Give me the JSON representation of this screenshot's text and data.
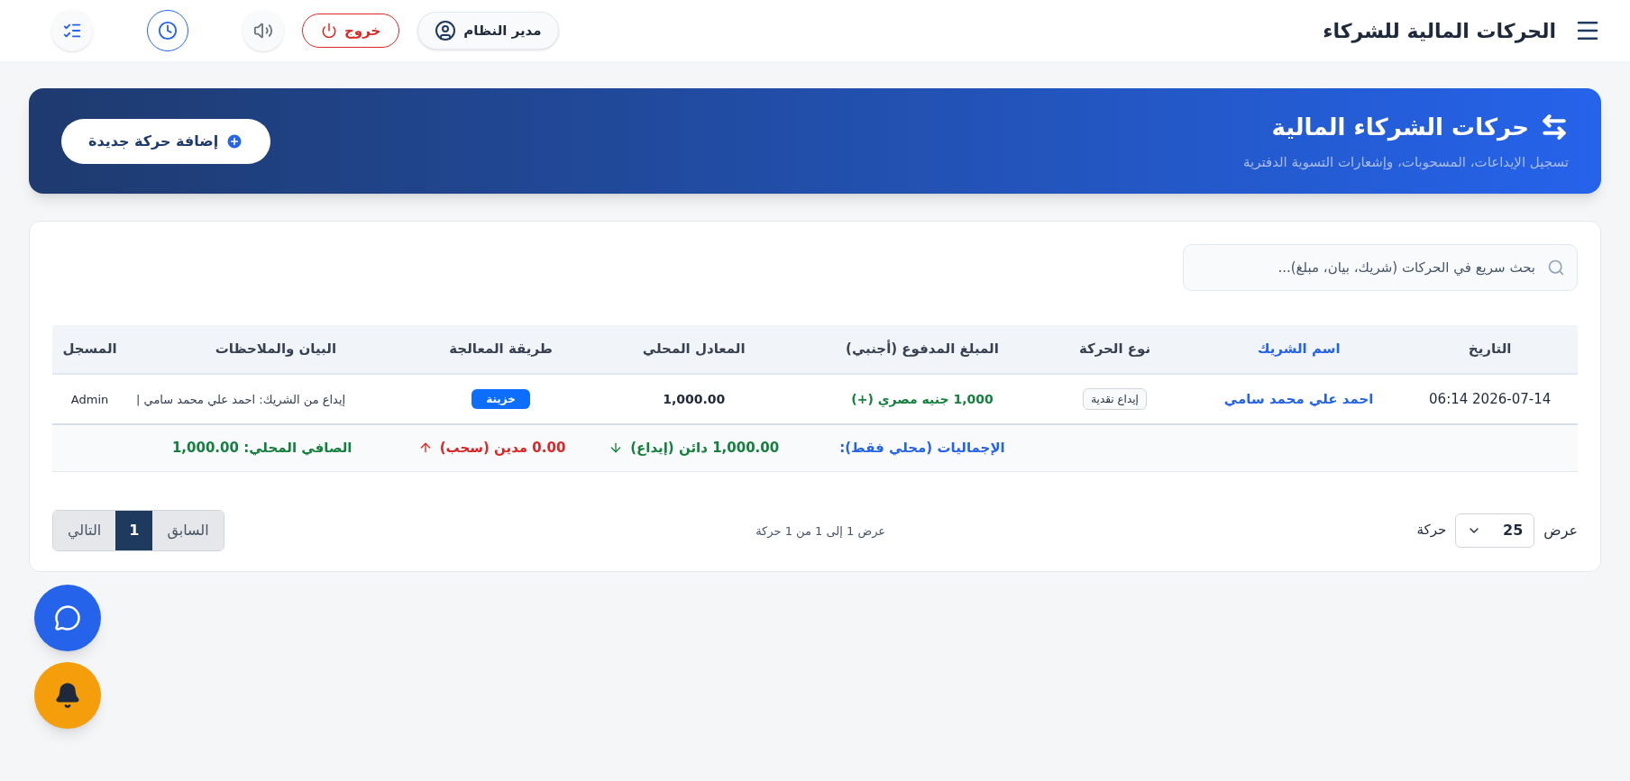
{
  "topbar": {
    "title": "الحركات المالية للشركاء",
    "user": "مدير النظام",
    "logout": "خروج"
  },
  "banner": {
    "title": "حركات الشركاء المالية",
    "subtitle": "تسجيل الإيداعات، المسحوبات، وإشعارات التسوية الدفترية",
    "add_button": "إضافة حركة جديدة"
  },
  "search": {
    "placeholder": "بحث سريع في الحركات (شريك، بيان، مبلغ)..."
  },
  "table": {
    "columns": [
      {
        "label": "التاريخ",
        "sorted": false
      },
      {
        "label": "اسم الشريك",
        "sorted": true
      },
      {
        "label": "نوع الحركة",
        "sorted": false
      },
      {
        "label": "المبلغ المدفوع (أجنبي)",
        "sorted": false
      },
      {
        "label": "المعادل المحلي",
        "sorted": false
      },
      {
        "label": "طريقة المعالجة",
        "sorted": false
      },
      {
        "label": "البيان والملاحظات",
        "sorted": false
      },
      {
        "label": "المسجل",
        "sorted": false
      }
    ],
    "rows": [
      {
        "date": "2026-07-14 06:14",
        "partner": "احمد علي محمد سامي",
        "type": "إيداع نقدية",
        "foreign_amount": "1,000 جنيه مصري (+)",
        "local_amount": "1,000.00",
        "method": "خزينة",
        "notes": "إيداع من الشريك: احمد علي محمد سامي |",
        "recorder": "Admin"
      }
    ],
    "totals": {
      "label": "الإجماليات (محلي فقط):",
      "credit": "1,000.00 دائن (إيداع)",
      "debit": "0.00 مدين (سحب)",
      "net": "الصافي المحلي: 1,000.00"
    }
  },
  "pagination": {
    "show_label": "عرض",
    "page_size": "25",
    "unit": "حركة",
    "summary": "عرض 1 إلى 1 من 1 حركة",
    "previous": "السابق",
    "pages": [
      {
        "label": "1",
        "selected": true
      }
    ],
    "next": "التالي"
  }
}
